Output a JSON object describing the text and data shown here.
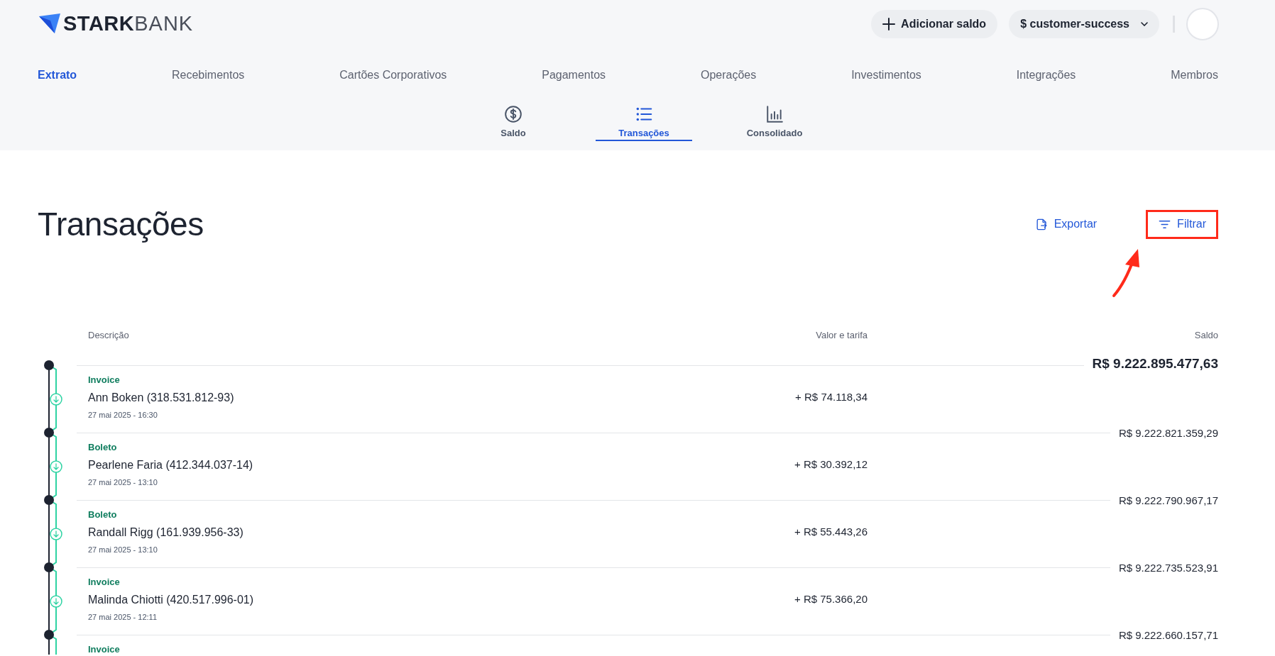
{
  "header": {
    "logo": {
      "bold": "STARK",
      "light": "BANK"
    },
    "add_button": "Adicionar saldo",
    "workspace_button": "$ customer-success"
  },
  "nav": [
    {
      "label": "Extrato",
      "selected": true
    },
    {
      "label": "Recebimentos",
      "selected": false
    },
    {
      "label": "Cartões Corporativos",
      "selected": false
    },
    {
      "label": "Pagamentos",
      "selected": false
    },
    {
      "label": "Operações",
      "selected": false
    },
    {
      "label": "Investimentos",
      "selected": false
    },
    {
      "label": "Integrações",
      "selected": false
    },
    {
      "label": "Membros",
      "selected": false
    }
  ],
  "subtabs": [
    {
      "label": "Saldo",
      "selected": false
    },
    {
      "label": "Transações",
      "selected": true
    },
    {
      "label": "Consolidado",
      "selected": false
    }
  ],
  "page_title": "Transações",
  "actions": [
    {
      "label": "Exportar",
      "highlighted": false
    },
    {
      "label": "Filtrar",
      "highlighted": true
    }
  ],
  "table": {
    "columns": [
      "Descrição",
      "Valor e tarifa",
      "Saldo"
    ],
    "rows": [
      {
        "balance": "R$ 9.222.895.477,63",
        "type": "Invoice",
        "name": "Ann Boken (318.531.812-93)",
        "date": "27 mai 2025 - 16:30",
        "amount": "+ R$ 74.118,34"
      },
      {
        "balance": "R$ 9.222.821.359,29",
        "type": "Boleto",
        "name": "Pearlene Faria (412.344.037-14)",
        "date": "27 mai 2025 - 13:10",
        "amount": "+ R$ 30.392,12"
      },
      {
        "balance": "R$ 9.222.790.967,17",
        "type": "Boleto",
        "name": "Randall Rigg (161.939.956-33)",
        "date": "27 mai 2025 - 13:10",
        "amount": "+ R$ 55.443,26"
      },
      {
        "balance": "R$ 9.222.735.523,91",
        "type": "Invoice",
        "name": "Malinda Chiotti (420.517.996-01)",
        "date": "27 mai 2025 - 12:11",
        "amount": "+ R$ 75.366,20"
      },
      {
        "balance": "R$ 9.222.660.157,71",
        "type": "Invoice"
      }
    ]
  }
}
